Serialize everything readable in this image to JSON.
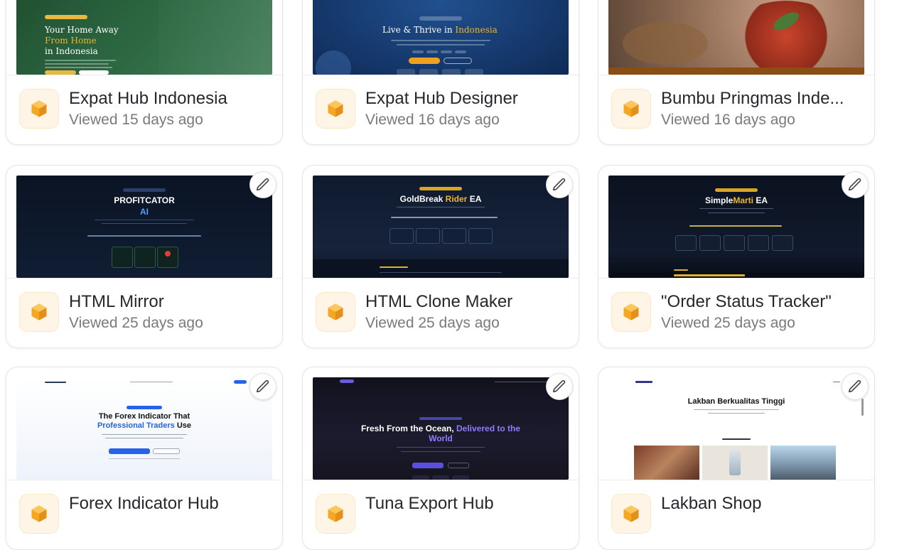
{
  "accent_color": "#f5a623",
  "cards": [
    {
      "title": "Expat Hub Indonesia",
      "subtitle": "Viewed 15 days ago",
      "icon": "cube-icon",
      "preview": {
        "line1": "Your Home Away",
        "line2": "From Home",
        "line3": "in Indonesia"
      }
    },
    {
      "title": "Expat Hub Designer",
      "subtitle": "Viewed 16 days ago",
      "icon": "cube-icon",
      "preview": {
        "heading_a": "Live & Thrive in",
        "heading_b": "Indonesia"
      }
    },
    {
      "title": "Bumbu Pringmas Inde...",
      "subtitle": "Viewed 16 days ago",
      "icon": "cube-icon",
      "preview": {}
    },
    {
      "title": "HTML Mirror",
      "subtitle": "Viewed 25 days ago",
      "icon": "cube-icon",
      "preview": {
        "heading_a": "PROFITCATOR",
        "heading_b": "AI"
      }
    },
    {
      "title": "HTML Clone Maker",
      "subtitle": "Viewed 25 days ago",
      "icon": "cube-icon",
      "preview": {
        "heading_a": "GoldBreak",
        "heading_b": "Rider",
        "heading_c": "EA"
      }
    },
    {
      "title": "\"Order Status Tracker\"",
      "subtitle": "Viewed 25 days ago",
      "icon": "cube-icon",
      "preview": {
        "heading_a": "Simple",
        "heading_b": "Marti",
        "heading_c": "EA"
      }
    },
    {
      "title": "Forex Indicator Hub",
      "subtitle": "",
      "icon": "cube-icon",
      "preview": {
        "line1": "The Forex Indicator That",
        "line2a": "Professional Traders",
        "line2b": "Use"
      }
    },
    {
      "title": "Tuna Export Hub",
      "subtitle": "",
      "icon": "cube-icon",
      "preview": {
        "line1a": "Fresh From the Ocean,",
        "line1b": "Delivered to the",
        "line2": "World"
      }
    },
    {
      "title": "Lakban Shop",
      "subtitle": "",
      "icon": "cube-icon",
      "preview": {
        "heading": "Lakban Berkualitas Tinggi"
      }
    }
  ]
}
